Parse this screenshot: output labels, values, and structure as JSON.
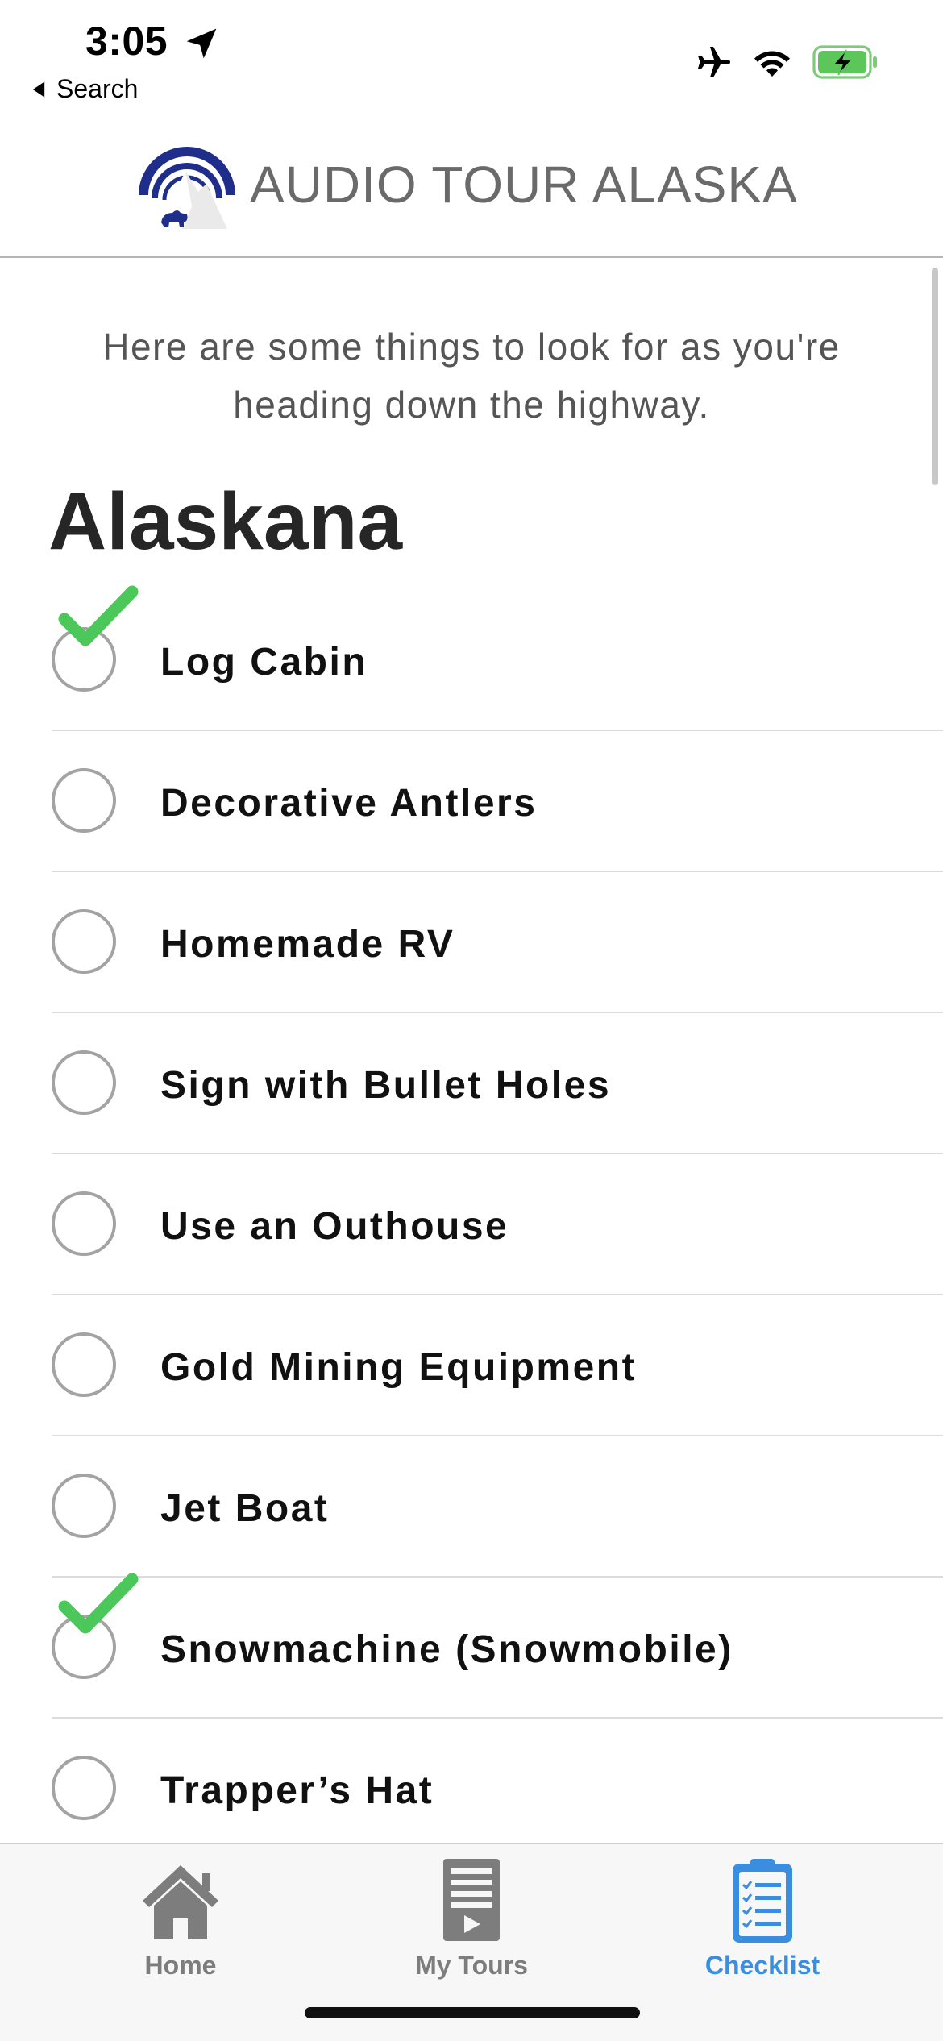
{
  "status_bar": {
    "time": "3:05",
    "back_label": "Search"
  },
  "header": {
    "title": "AUDIO TOUR ALASKA"
  },
  "intro_text": "Here are some things to look for as you're heading down the highway.",
  "section_title": "Alaskana",
  "checklist": [
    {
      "label": "Log Cabin",
      "checked": true
    },
    {
      "label": "Decorative Antlers",
      "checked": false
    },
    {
      "label": "Homemade RV",
      "checked": false
    },
    {
      "label": "Sign with Bullet Holes",
      "checked": false
    },
    {
      "label": "Use an Outhouse",
      "checked": false
    },
    {
      "label": "Gold Mining Equipment",
      "checked": false
    },
    {
      "label": "Jet Boat",
      "checked": false
    },
    {
      "label": "Snowmachine (Snowmobile)",
      "checked": true
    },
    {
      "label": "Trapper’s Hat",
      "checked": false
    }
  ],
  "tabs": [
    {
      "label": "Home",
      "icon": "house-icon",
      "active": false
    },
    {
      "label": "My Tours",
      "icon": "tour-document-icon",
      "active": false
    },
    {
      "label": "Checklist",
      "icon": "clipboard-checklist-icon",
      "active": true
    }
  ],
  "colors": {
    "accent": "#3b8de0",
    "check_green": "#4cc85a",
    "logo_navy": "#1e2e8a",
    "inactive_tab": "#7d7d7d"
  }
}
